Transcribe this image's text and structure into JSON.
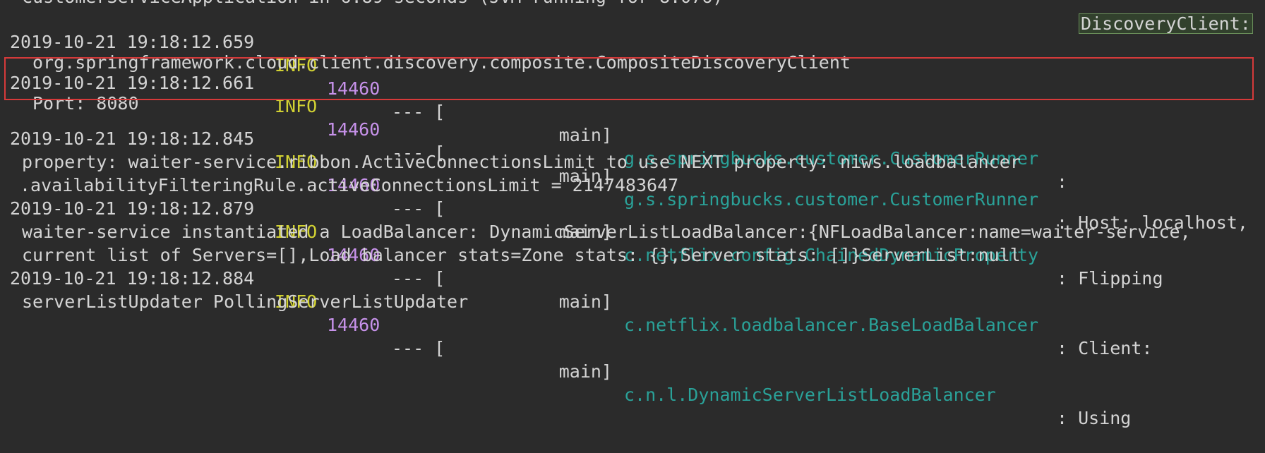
{
  "console": {
    "partial_top_line": "CustomerServiceApplication in 6.89 seconds (JVM running for 8.076)",
    "entries": [
      {
        "timestamp": "2019-10-21 19:18:12.659",
        "level": "INFO",
        "pid": "14460",
        "separator": "--- [",
        "thread": "main]",
        "logger": "g.s.springbucks.customer.CustomerRunner",
        "message": ": DiscoveryClient:",
        "continuation": [
          "org.springframework.cloud.client.discovery.composite.CompositeDiscoveryClient"
        ]
      },
      {
        "timestamp": "2019-10-21 19:18:12.661",
        "level": "INFO",
        "pid": "14460",
        "separator": "--- [",
        "thread": "main]",
        "logger": "g.s.springbucks.customer.CustomerRunner",
        "message": ": Host: localhost,",
        "continuation": [
          "Port: 8080"
        ]
      },
      {
        "timestamp": "2019-10-21 19:18:12.845",
        "level": "INFO",
        "pid": "14460",
        "separator": "--- [",
        "thread": "main]",
        "logger": "c.netflix.config.ChainedDynamicProperty",
        "message": ": Flipping",
        "continuation": [
          "property: waiter-service.ribbon.ActiveConnectionsLimit to use NEXT property: niws.loadbalancer",
          ".availabilityFilteringRule.activeConnectionsLimit = 2147483647"
        ]
      },
      {
        "timestamp": "2019-10-21 19:18:12.879",
        "level": "INFO",
        "pid": "14460",
        "separator": "--- [",
        "thread": "main]",
        "logger": "c.netflix.loadbalancer.BaseLoadBalancer",
        "message": ": Client:",
        "continuation": [
          "waiter-service instantiated a LoadBalancer: DynamicServerListLoadBalancer:{NFLoadBalancer:name=waiter-service,",
          "current list of Servers=[],Load balancer stats=Zone stats: {},Server stats: []}ServerList:null"
        ]
      },
      {
        "timestamp": "2019-10-21 19:18:12.884",
        "level": "INFO",
        "pid": "14460",
        "separator": "--- [",
        "thread": "main]",
        "logger": "c.n.l.DynamicServerListLoadBalancer",
        "message": ": Using",
        "continuation": [
          "serverListUpdater PollingServerListUpdater"
        ]
      }
    ],
    "highlight_word": "DiscoveryClient:"
  },
  "colors": {
    "background": "#2b2b2b",
    "text": "#d4d4d4",
    "level_info": "#d2d233",
    "pid": "#c792ea",
    "logger": "#2aa198",
    "selection_box": "#d63a3a"
  }
}
